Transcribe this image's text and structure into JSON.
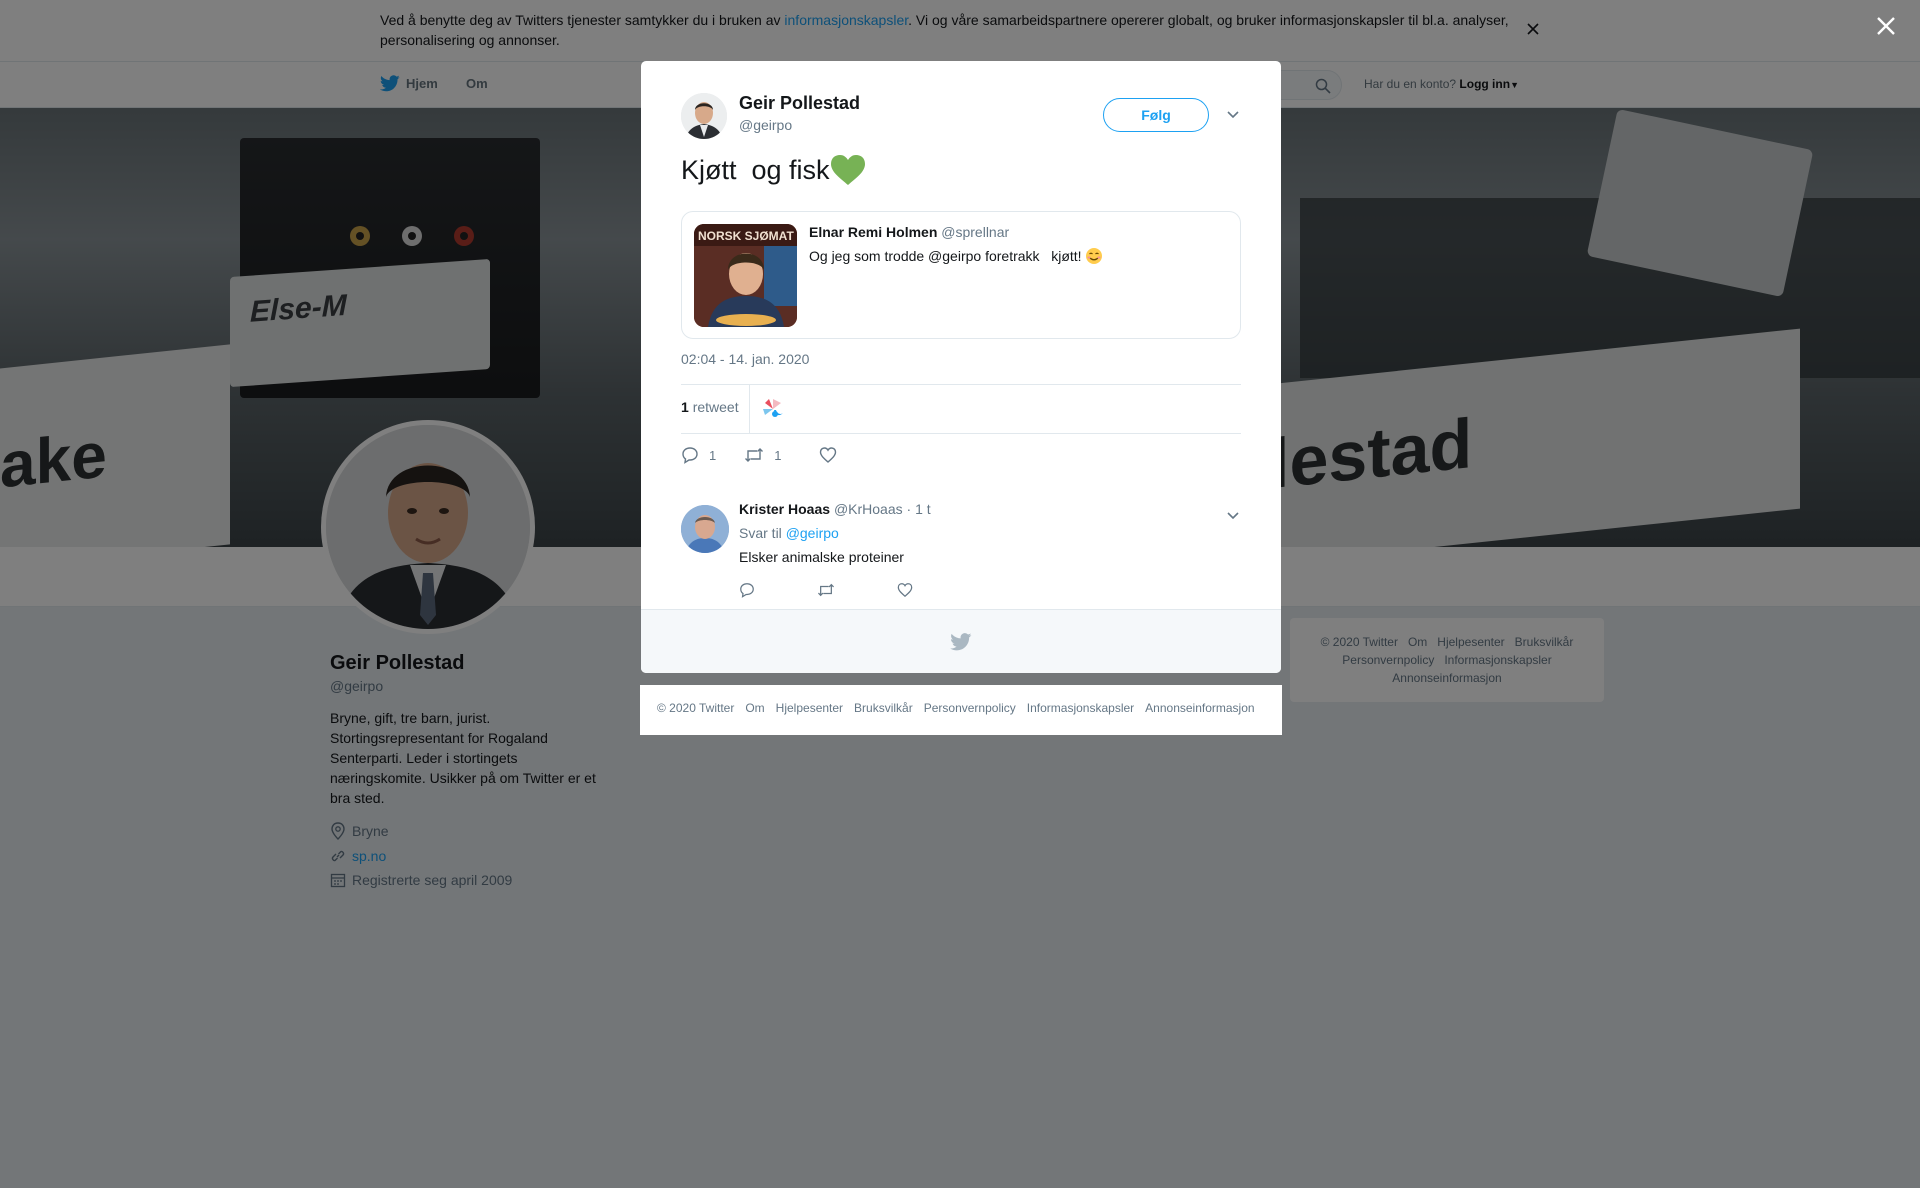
{
  "cookie": {
    "text_before": "Ved å benytte deg av Twitters tjenester samtykker du i bruken av ",
    "link": "informasjonskapsler",
    "text_after": ". Vi og våre samarbeidspartnere opererer globalt, og bruker informasjonskapsler til bl.a. analyser, personalisering og annonser."
  },
  "nav": {
    "home": "Hjem",
    "about": "Om",
    "has_account": "Har du en konto?",
    "login": "Logg inn"
  },
  "header_photo": {
    "sign_left": "Else-M",
    "sign_bottom_left": "ake",
    "sign_right": "lestad"
  },
  "profile": {
    "name": "Geir Pollestad",
    "handle": "@geirpo",
    "bio": "Bryne, gift, tre barn, jurist. Stortingsrepresentant for Rogaland Senterparti. Leder i stortingets næringskomite. Usikker på om Twitter er et bra sted.",
    "location": "Bryne",
    "url": "sp.no",
    "joined": "Registrerte seg april 2009"
  },
  "footer_links": [
    "© 2020 Twitter",
    "Om",
    "Hjelpesenter",
    "Bruksvilkår",
    "Personvernpolicy",
    "Informasjonskapsler",
    "Annonseinformasjon"
  ],
  "modal": {
    "author_name": "Geir Pollestad",
    "author_handle": "@geirpo",
    "follow": "Følg",
    "tweet_text": "Kjøtt  og fisk",
    "quote": {
      "name": "Elnar Remi Holmen",
      "handle": "@sprellnar",
      "text": "Og jeg som trodde @geirpo foretrakk   kjøtt!",
      "image_text": "NORSK SJØMAT"
    },
    "timestamp": "02:04 - 14. jan. 2020",
    "retweet_count": "1",
    "retweet_label": "retweet",
    "reply_count": "1",
    "rt_count": "1",
    "reply": {
      "name": "Krister Hoaas",
      "handle": "@KrHoaas",
      "time": "· 1 t",
      "reply_to_label": "Svar til",
      "reply_to": "@geirpo",
      "text": "Elsker animalske proteiner"
    }
  },
  "colors": {
    "accent": "#1da1f2",
    "like_heart": "#77b255",
    "overlay": "rgba(0,0,0,0.5)"
  }
}
